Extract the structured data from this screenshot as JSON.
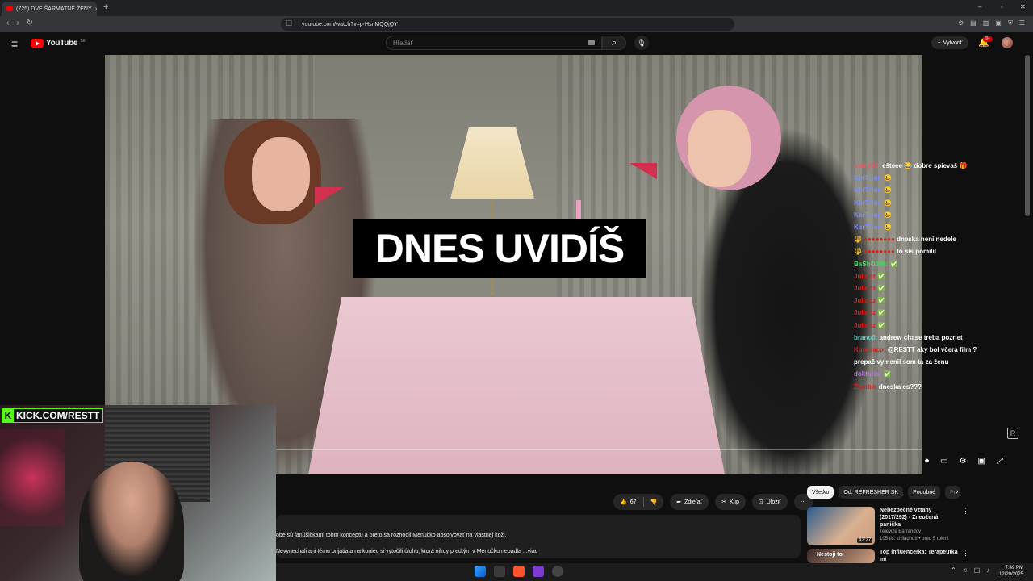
{
  "browser": {
    "tab_title": "(725) DVE ŠARMATNÉ ŽENY",
    "tab_close": "×",
    "new_tab": "+",
    "url": "youtube.com/watch?v=p-HsnMQQjQY",
    "window_controls": [
      "–",
      "▫",
      "✕"
    ]
  },
  "header": {
    "logo_text": "YouTube",
    "logo_country": "SK",
    "search_placeholder": "Hľadať",
    "create_label": "Vytvoriť",
    "notifications_badge": "9+"
  },
  "video": {
    "caption": "DNES UVIDÍŠ"
  },
  "chat": [
    {
      "user": "matty31:",
      "msg": "ešteee 😂 dobre spievaš 🎁",
      "color": "#e05a6a"
    },
    {
      "user": "KarTiJer:",
      "msg": "😃",
      "color": "#7a8cff"
    },
    {
      "user": "KarTiJer:",
      "msg": "😃",
      "color": "#7a8cff"
    },
    {
      "user": "KarTiJer:",
      "msg": "😃",
      "color": "#7a8cff"
    },
    {
      "user": "KarTiJer:",
      "msg": "😃",
      "color": "#7a8cff"
    },
    {
      "user": "KarTiJer:",
      "msg": "😃",
      "color": "#7a8cff"
    },
    {
      "user": "🔱 ●●●●●●●●",
      "msg": "dneska neni nedele",
      "color": "#d0231f"
    },
    {
      "user": "🔱 ●●●●●●●●",
      "msg": "to sis pomilil",
      "color": "#d0231f"
    },
    {
      "user": "BaShO596:",
      "msg": "✅",
      "color": "#4ad865"
    },
    {
      "user": "Juliocz",
      "msg": "✅",
      "color": "#d0231f"
    },
    {
      "user": "Juliocz",
      "msg": "✅",
      "color": "#d0231f"
    },
    {
      "user": "Juliocz",
      "msg": "✅",
      "color": "#d0231f"
    },
    {
      "user": "Juliocz",
      "msg": "✅",
      "color": "#d0231f"
    },
    {
      "user": "Juliocz",
      "msg": "✅",
      "color": "#d0231f"
    },
    {
      "user": "brano6:",
      "msg": "andrew chase treba pozriet",
      "color": "#52d0c8"
    },
    {
      "user": "Kurepaco:",
      "msg": "@RESTT aky bol včera film ?",
      "color": "#d0231f"
    },
    {
      "user": "",
      "msg": "prepač vymenil som ta za ženu",
      "color": "#ffffff"
    },
    {
      "user": "doktoris:",
      "msg": "✅",
      "color": "#b07ae0"
    },
    {
      "user": "Zombie",
      "msg": "dneska cs???",
      "color": "#d0231f"
    }
  ],
  "stream": {
    "kick_label": "KICK.COM/RESTT"
  },
  "actions": {
    "like_count": "67",
    "share_label": "Zdieľať",
    "clip_label": "Klip",
    "save_label": "Uložiť",
    "more": "⋯"
  },
  "description": {
    "line1": "obe sú fanúšičkami tohto konceptu a preto sa rozhodli Menučko absolvovať na vlastnej koži.",
    "line2": "Nevynechali ani tému prijatia a na koniec si vytočili úlohu, ktorá nikdy predtým v Menučku nepadla ...viac"
  },
  "chips": [
    "Všetko",
    "Od: REFRESHER SK",
    "Podobné",
    "Pr"
  ],
  "recommendations": [
    {
      "title": "Nebezpečné vztahy (2017/292) - Zneužená panička",
      "channel": "Televize Barrandov",
      "meta": "105 tis. zhliadnutí • pred 5 rokmi",
      "duration": "42:27"
    },
    {
      "title": "Top influencerka: Terapeutka mi",
      "channel": "",
      "meta": "",
      "duration": ""
    }
  ],
  "overlay_text": {
    "rec2_thumb": "Nestoji to"
  },
  "clock": {
    "time": "7:49 PM",
    "date": "12/20/2025"
  }
}
